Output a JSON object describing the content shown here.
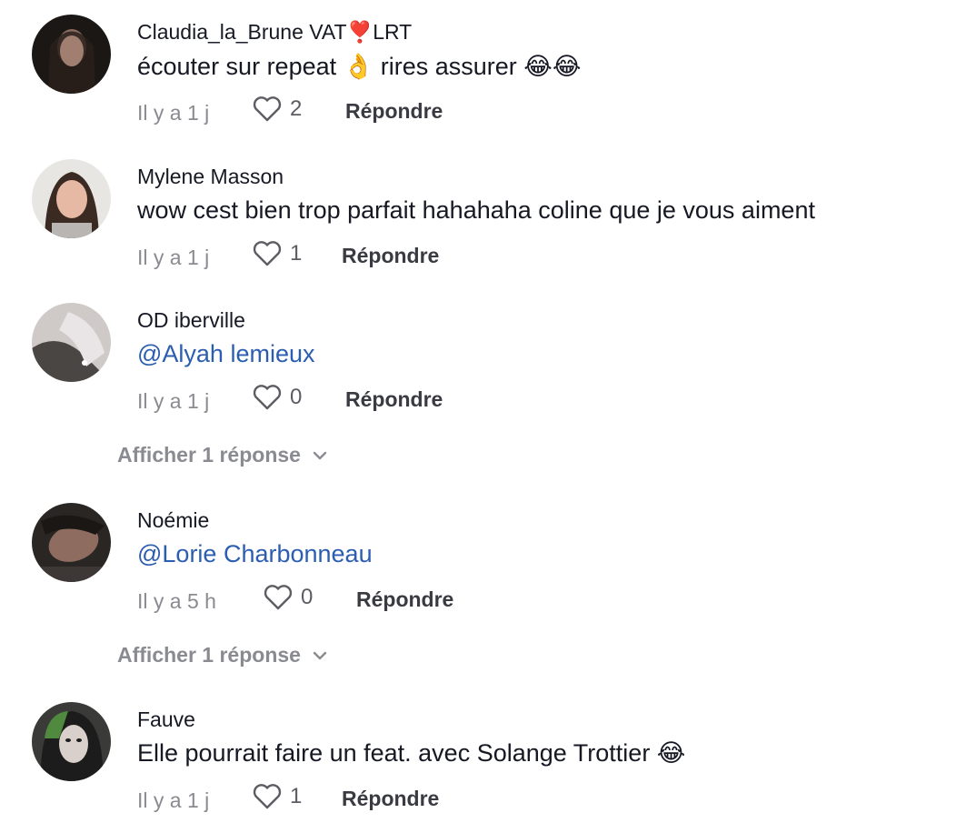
{
  "comments": [
    {
      "username": "Claudia_la_Brune VAT❣️LRT",
      "text": "écouter sur repeat 👌 rires assurer 😂😂",
      "time": "Il y a 1 j",
      "likes": "2",
      "reply_label": "Répondre"
    },
    {
      "username": "Mylene Masson",
      "text": "wow cest bien trop parfait hahahaha coline que je vous aiment",
      "time": "Il y a 1 j",
      "likes": "1",
      "reply_label": "Répondre"
    },
    {
      "username": "OD iberville",
      "text": "@Alyah lemieux",
      "time": "Il y a 1 j",
      "likes": "0",
      "reply_label": "Répondre",
      "show_replies": "Afficher 1 réponse"
    },
    {
      "username": "Noémie",
      "text": "@Lorie Charbonneau",
      "time": "Il y a 5 h",
      "likes": "0",
      "reply_label": "Répondre",
      "show_replies": "Afficher 1 réponse"
    },
    {
      "username": "Fauve",
      "text": "Elle pourrait faire un feat. avec Solange Trottier 😂",
      "time": "Il y a 1 j",
      "likes": "1",
      "reply_label": "Répondre"
    }
  ],
  "colors": {
    "text": "#161823",
    "mention": "#2b5db0",
    "secondary": "#8a8b91"
  }
}
